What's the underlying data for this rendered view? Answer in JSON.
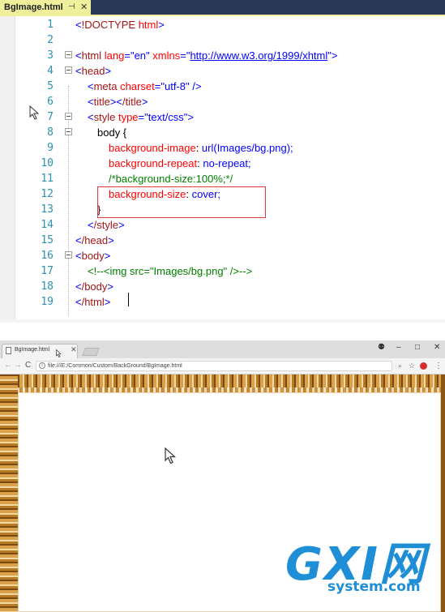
{
  "editor": {
    "tab": {
      "title": "BgImage.html",
      "pin_icon": "pin-icon",
      "close_icon": "close-icon"
    },
    "lines": [
      {
        "n": "1"
      },
      {
        "n": "2"
      },
      {
        "n": "3"
      },
      {
        "n": "4"
      },
      {
        "n": "5"
      },
      {
        "n": "6"
      },
      {
        "n": "7"
      },
      {
        "n": "8"
      },
      {
        "n": "9"
      },
      {
        "n": "10"
      },
      {
        "n": "11"
      },
      {
        "n": "12"
      },
      {
        "n": "13"
      },
      {
        "n": "14"
      },
      {
        "n": "15"
      },
      {
        "n": "16"
      },
      {
        "n": "17"
      },
      {
        "n": "18"
      },
      {
        "n": "19"
      }
    ],
    "code": {
      "l1_doctype": "!DOCTYPE",
      "l1_html": "html",
      "l3_tag": "html",
      "l3_attr_lang": "lang",
      "l3_val_lang": "\"en\"",
      "l3_attr_xmlns": "xmlns",
      "l3_val_xmlns": "http://www.w3.org/1999/xhtml",
      "l4_tag": "head",
      "l5_tag": "meta",
      "l5_attr": "charset",
      "l5_val": "\"utf-8\"",
      "l6_open": "title",
      "l6_close": "/title",
      "l7_tag": "style",
      "l7_attr": "type",
      "l7_val": "\"text/css\"",
      "l8_selector": "body {",
      "l9_prop": "background-image",
      "l9_value": "url(Images/bg.png);",
      "l10_prop": "background-repeat",
      "l10_value": "no-repeat;",
      "l11_comment": "/*background-size:100%;*/",
      "l12_prop": "background-size",
      "l12_value": "cover;",
      "l13_brace": "}",
      "l14_tag": "/style",
      "l15_tag": "/head",
      "l16_tag": "body",
      "l17_comment": "<!--<img src=\"Images/bg.png\" />-->",
      "l18_tag": "/body",
      "l19_tag": "/html"
    },
    "highlight_color": "#e33b3b"
  },
  "browser": {
    "tab_title": "BgImage.html",
    "url": "file:///E:/Common/Custom/BackGround/BgImage.html",
    "window_controls": {
      "user": "⚉",
      "minimize": "–",
      "maximize": "□",
      "close": "✕"
    },
    "nav": {
      "back": "←",
      "forward": "→",
      "reload": "C"
    },
    "toolbar_icons": {
      "zoom": "⌕",
      "star": "☆",
      "menu": "⋮"
    }
  },
  "watermark": {
    "big": "GXI网",
    "small": "system.com"
  }
}
